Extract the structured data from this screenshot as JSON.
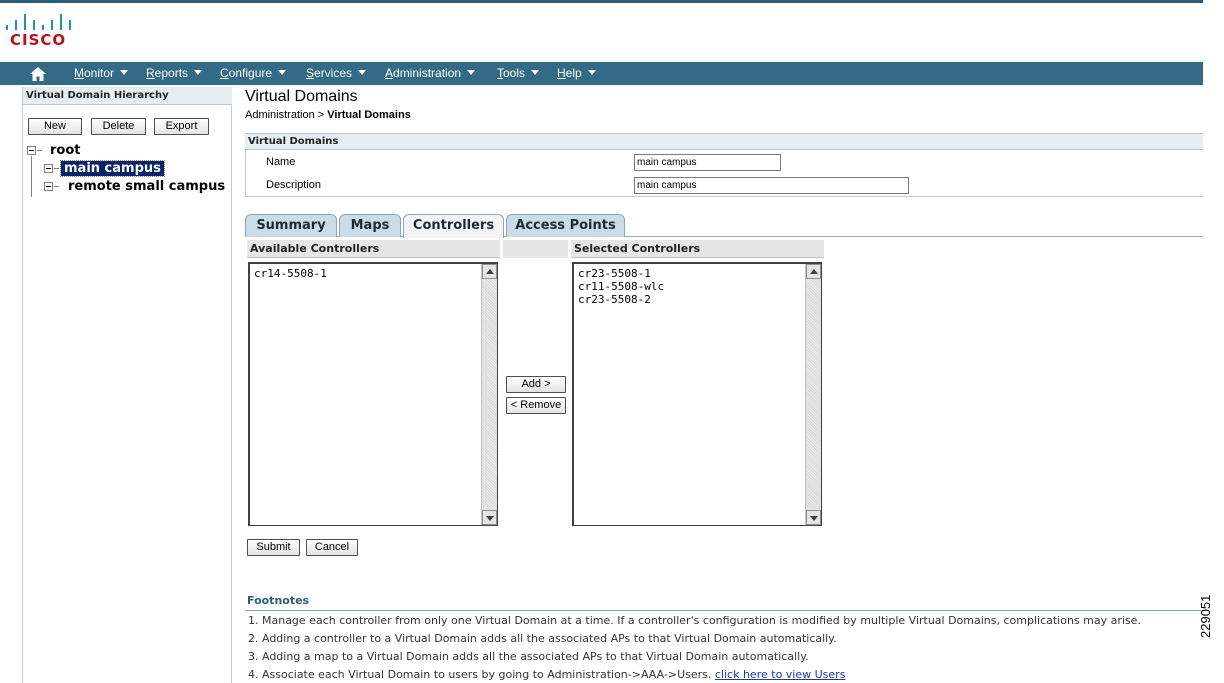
{
  "brand": {
    "logo_text": "CISCO",
    "accent": "#336a85",
    "logo_red": "#b5121b",
    "logo_blue": "#1f8fbf"
  },
  "nav": {
    "items": [
      {
        "hotkey": "M",
        "rest": "onitor"
      },
      {
        "hotkey": "R",
        "rest": "eports"
      },
      {
        "hotkey": "C",
        "rest": "onfigure"
      },
      {
        "hotkey": "S",
        "rest": "ervices"
      },
      {
        "hotkey": "A",
        "rest": "dministration"
      },
      {
        "hotkey": "T",
        "rest": "ools"
      },
      {
        "hotkey": "H",
        "rest": "elp"
      }
    ]
  },
  "left": {
    "header": "Virtual Domain Hierarchy",
    "buttons": {
      "new": "New",
      "delete": "Delete",
      "export": "Export"
    },
    "tree": {
      "root": "root",
      "children": [
        "main campus",
        "remote small campus"
      ]
    }
  },
  "page": {
    "title": "Virtual Domains",
    "breadcrumb_parent": "Administration",
    "breadcrumb_sep": ">",
    "breadcrumb_current": "Virtual Domains"
  },
  "form": {
    "section": "Virtual Domains",
    "name_label": "Name",
    "name_value": "main campus",
    "description_label": "Description",
    "description_value": "main campus"
  },
  "tabs": [
    "Summary",
    "Maps",
    "Controllers",
    "Access Points"
  ],
  "controllers": {
    "available_header": "Available Controllers",
    "selected_header": "Selected Controllers",
    "available": [
      "cr14-5508-1"
    ],
    "selected": [
      "cr23-5508-1",
      "cr11-5508-wlc",
      "cr23-5508-2"
    ],
    "add_label": "Add >",
    "remove_label": "< Remove"
  },
  "actions": {
    "submit": "Submit",
    "cancel": "Cancel"
  },
  "footnotes": {
    "title": "Footnotes",
    "items": [
      "1. Manage each controller from only one Virtual Domain at a time. If a controller's configuration is modified by multiple Virtual Domains, complications may arise.",
      "2. Adding a controller to a Virtual Domain adds all the associated APs to that Virtual Domain automatically.",
      "3. Adding a map to a Virtual Domain adds all the associated APs to that Virtual Domain automatically.",
      "4. Associate each Virtual Domain to users by going to Administration->AAA->Users. "
    ],
    "link": "click here to view Users"
  },
  "figure_id": "229051"
}
